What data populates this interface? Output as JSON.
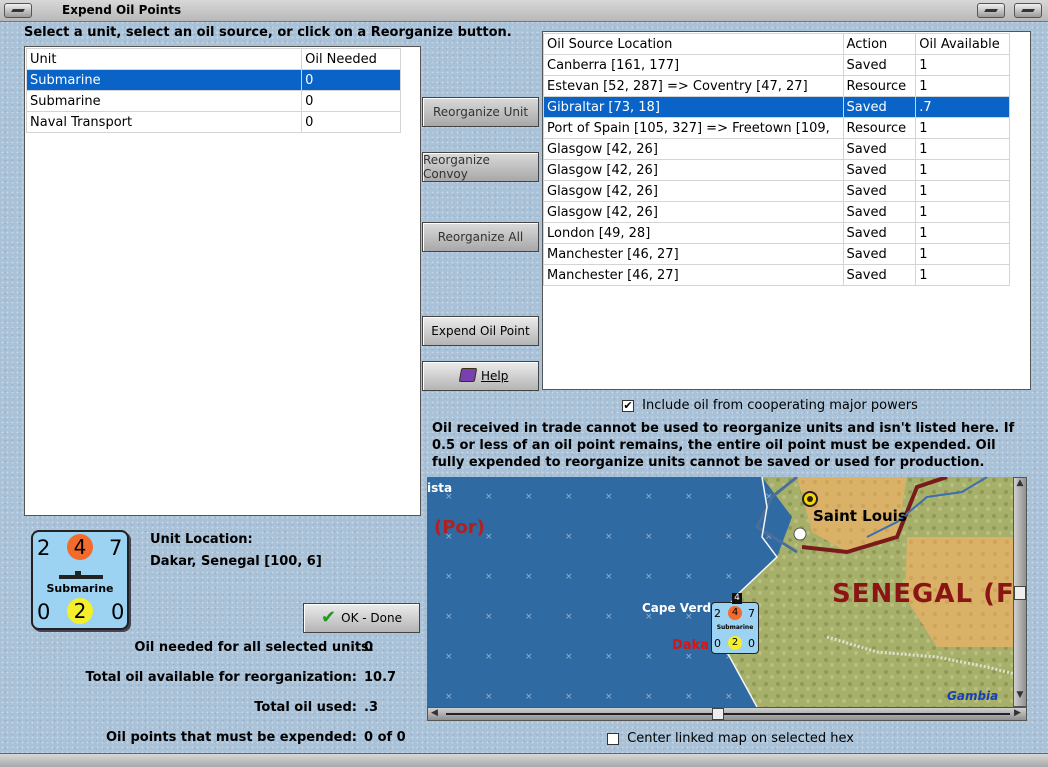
{
  "window": {
    "title": "Expend Oil Points"
  },
  "instruction": "Select a unit, select an oil source, or click on a Reorganize button.",
  "units_table": {
    "headers": [
      "Unit",
      "Oil Needed"
    ],
    "rows": [
      {
        "unit": "Submarine",
        "oil": "0"
      },
      {
        "unit": "Submarine",
        "oil": "0"
      },
      {
        "unit": "Naval Transport",
        "oil": "0"
      }
    ],
    "selected_index": 0
  },
  "oil_table": {
    "headers": [
      "Oil Source Location",
      "Action",
      "Oil Available"
    ],
    "rows": [
      {
        "loc": "Canberra [161, 177]",
        "action": "Saved",
        "avail": "1"
      },
      {
        "loc": "Estevan [52, 287] => Coventry [47, 27]",
        "action": "Resource",
        "avail": "1"
      },
      {
        "loc": "Gibraltar [73, 18]",
        "action": "Saved",
        "avail": ".7"
      },
      {
        "loc": "Port of Spain [105, 327] => Freetown [109,",
        "action": "Resource",
        "avail": "1"
      },
      {
        "loc": "Glasgow [42, 26]",
        "action": "Saved",
        "avail": "1"
      },
      {
        "loc": "Glasgow [42, 26]",
        "action": "Saved",
        "avail": "1"
      },
      {
        "loc": "Glasgow [42, 26]",
        "action": "Saved",
        "avail": "1"
      },
      {
        "loc": "Glasgow [42, 26]",
        "action": "Saved",
        "avail": "1"
      },
      {
        "loc": "London [49, 28]",
        "action": "Saved",
        "avail": "1"
      },
      {
        "loc": "Manchester [46, 27]",
        "action": "Saved",
        "avail": "1"
      },
      {
        "loc": "Manchester [46, 27]",
        "action": "Saved",
        "avail": "1"
      }
    ],
    "selected_index": 2
  },
  "buttons": {
    "reorganize_unit": "Reorganize Unit",
    "reorganize_convoy": "Reorganize Convoy",
    "reorganize_all": "Reorganize All",
    "expend_oil_point": "Expend Oil Point",
    "help": "Help",
    "ok_done": "OK - Done"
  },
  "include_oil_label": "Include oil from cooperating major powers",
  "include_oil_checked": true,
  "info_text": "Oil received in trade cannot be used to reorganize units and isn't listed here.  If 0.5 or less of an oil point remains, the entire oil point must be expended.   Oil fully expended to reorganize units cannot be saved or used for production.",
  "counter": {
    "top_left": "2",
    "top_mid": "4",
    "top_right": "7",
    "name": "Submarine",
    "bottom_left": "0",
    "bottom_mid": "2",
    "bottom_right": "0"
  },
  "unit_location": {
    "label": "Unit Location:",
    "value": "Dakar, Senegal [100, 6]"
  },
  "stats": {
    "needed_label": "Oil needed for all selected units:",
    "needed_value": "0",
    "total_label": "Total oil available for reorganization:",
    "total_value": "10.7",
    "used_label": "Total oil used:",
    "used_value": ".3",
    "expended_label": "Oil points that must be expended:",
    "expended_value": "0 of 0"
  },
  "map": {
    "labels": {
      "vista": "ista",
      "por": "(Por)",
      "saint_louis": "Saint Louis",
      "senegal": "SENEGAL (F",
      "cape_verde": "Cape Verd",
      "dakar": "Daka",
      "gambia": "Gambia"
    },
    "mini_counter": {
      "stack": "4",
      "tl": "2",
      "tm": "4",
      "tr": "7",
      "name": "Submarine",
      "bl": "0",
      "bm": "2",
      "br": "0"
    }
  },
  "center_map_label": "Center linked map on selected hex",
  "center_map_checked": false
}
